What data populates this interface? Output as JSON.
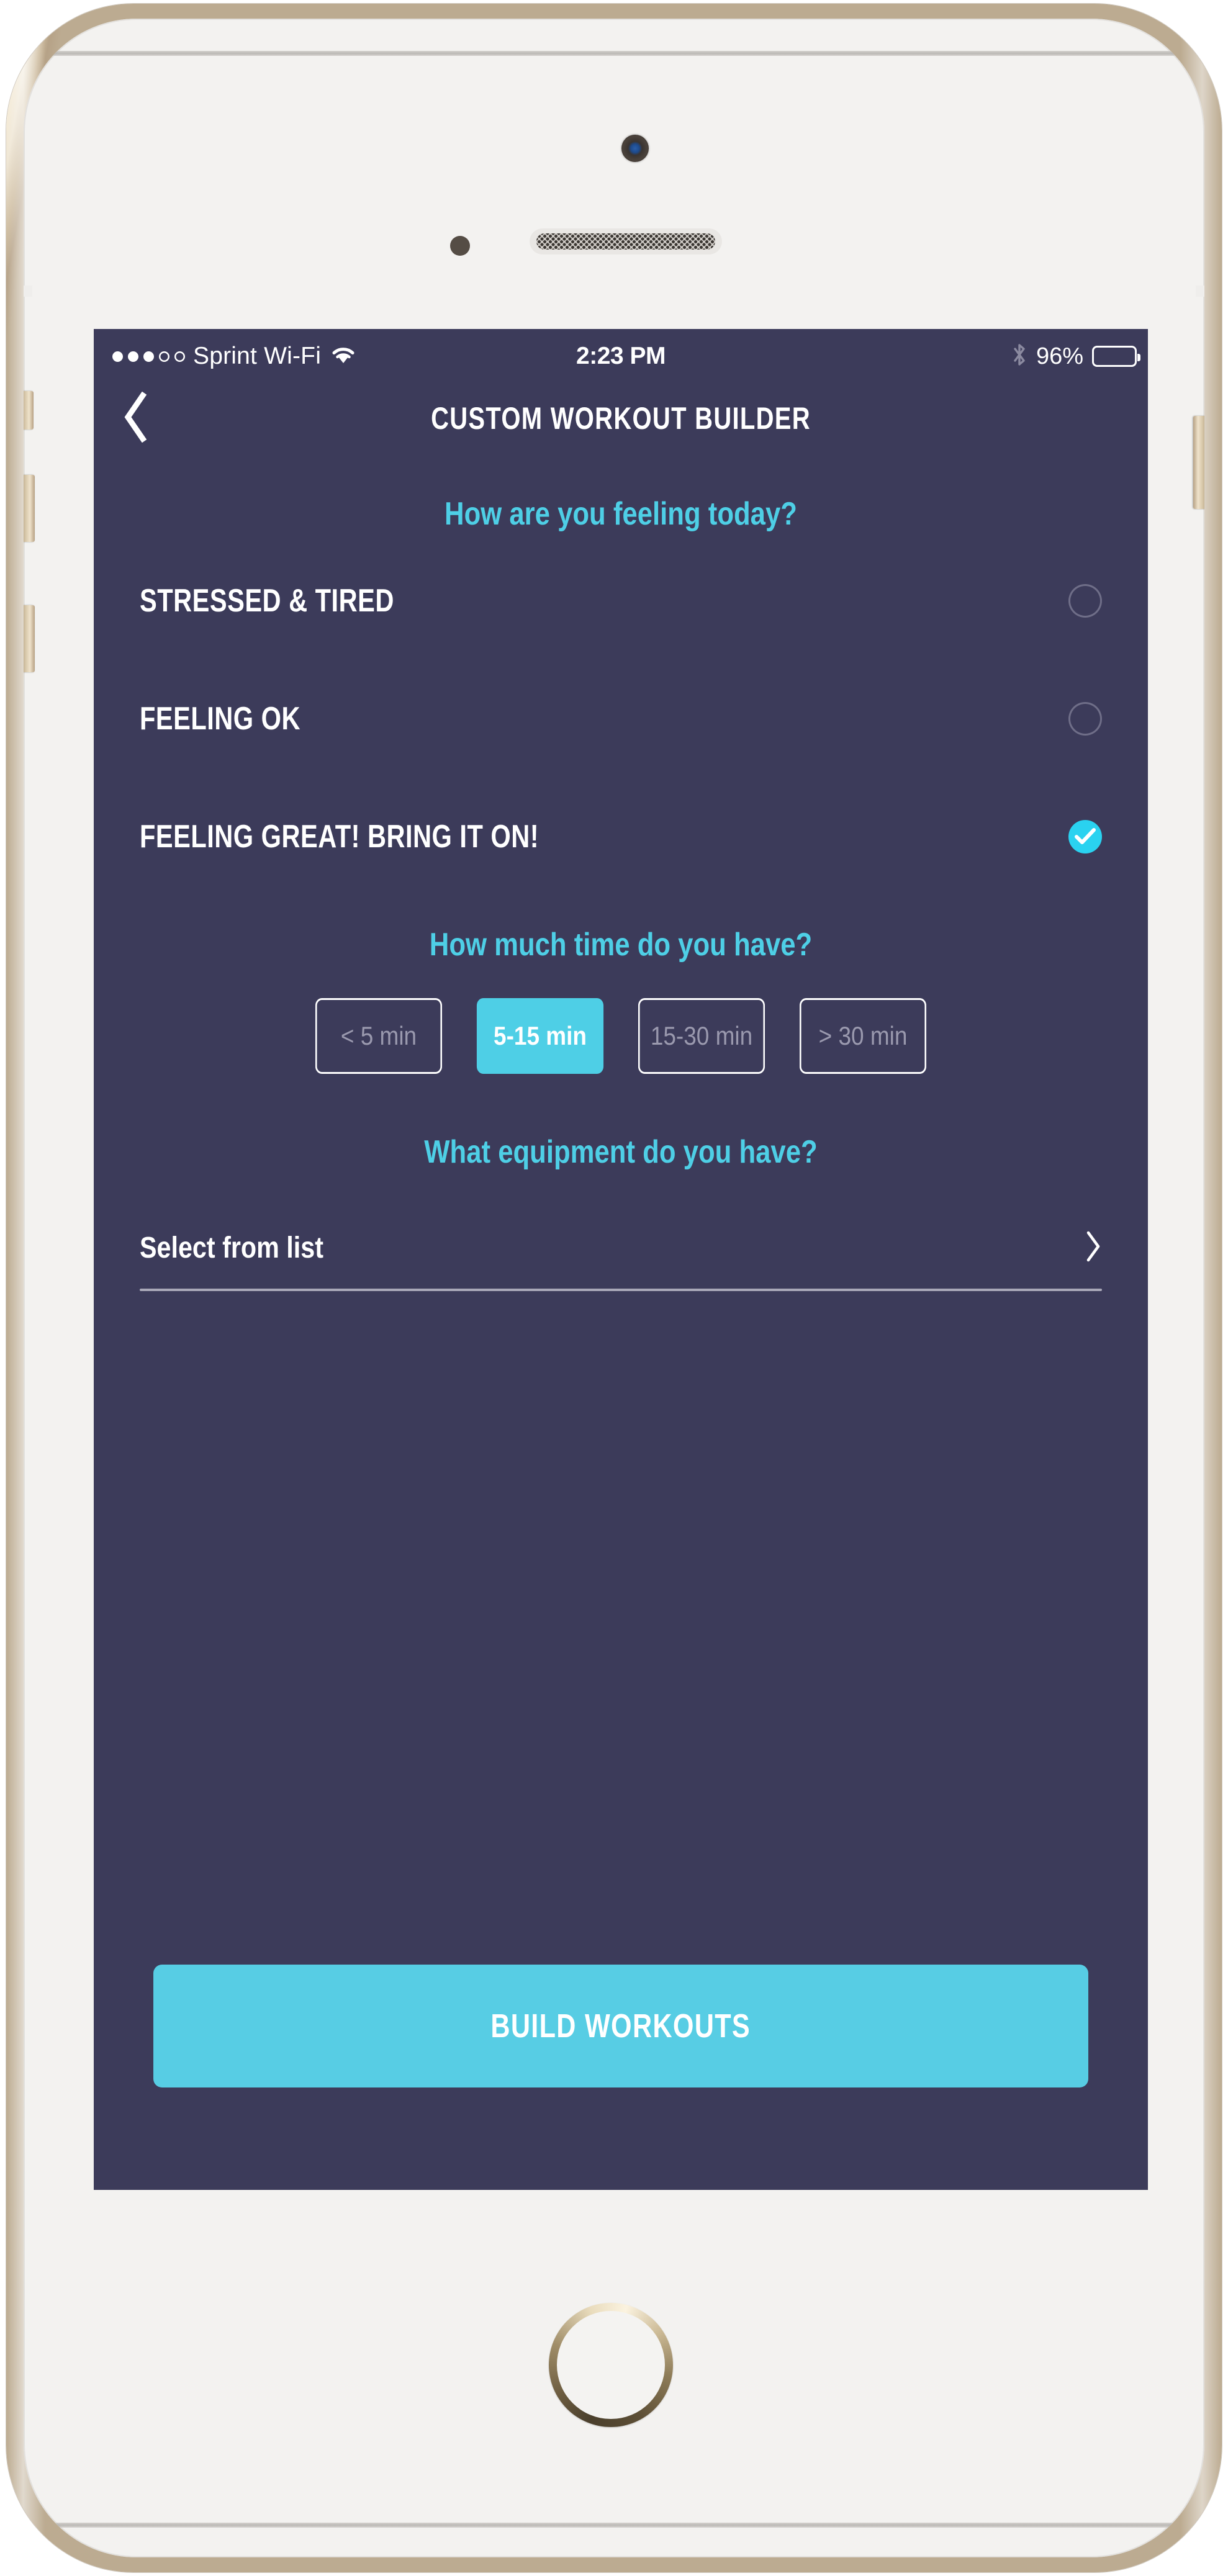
{
  "device": {
    "type": "smartphone-gold",
    "frame_color": "#c7b394",
    "face_color": "#f3f2f0"
  },
  "status_bar": {
    "signal_dots_filled": 3,
    "signal_dots_empty": 2,
    "carrier": "Sprint Wi-Fi",
    "wifi_icon": "wifi-icon",
    "time": "2:23 PM",
    "bluetooth_icon": "bluetooth-icon",
    "battery_percent": "96%",
    "battery_level": 96
  },
  "nav": {
    "back_icon": "chevron-left-icon",
    "title": "CUSTOM WORKOUT BUILDER"
  },
  "mood": {
    "heading": "How are you feeling today?",
    "options": [
      {
        "label": "STRESSED & TIRED",
        "selected": false
      },
      {
        "label": "FEELING OK",
        "selected": false
      },
      {
        "label": "FEELING GREAT! BRING IT ON!",
        "selected": true
      }
    ]
  },
  "time": {
    "heading": "How much time do you have?",
    "options": [
      {
        "label": "< 5 min",
        "selected": false
      },
      {
        "label": "5-15 min",
        "selected": true
      },
      {
        "label": "15-30 min",
        "selected": false
      },
      {
        "label": "> 30 min",
        "selected": false
      }
    ]
  },
  "equipment": {
    "heading": "What equipment do you have?",
    "select_label": "Select from list",
    "disclosure_icon": "chevron-right-icon"
  },
  "cta": {
    "label": "BUILD WORKOUTS"
  },
  "colors": {
    "screen_background": "#3c3b5a",
    "accent_cyan": "#4ecfe6",
    "check_cyan": "#2ad2f0",
    "text_white": "#ffffff",
    "muted_text": "#9a99ae",
    "radio_outline": "#6f6e88",
    "divider": "#a9a8b8"
  }
}
